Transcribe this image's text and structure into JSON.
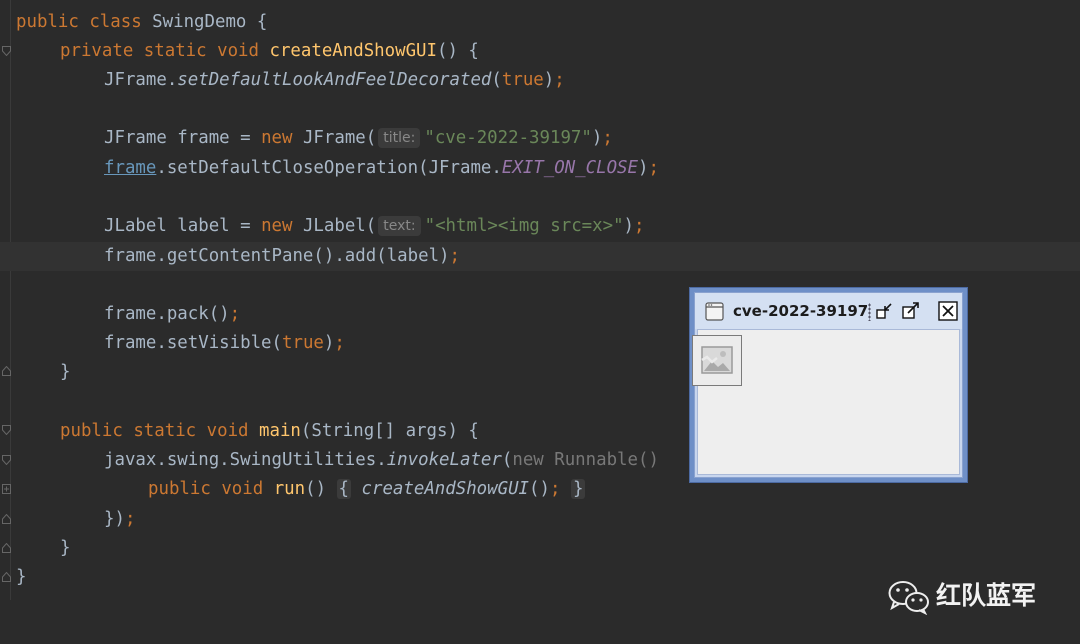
{
  "code": {
    "l1": {
      "k1": "public",
      "k2": "class",
      "name": "SwingDemo",
      "tail": " {"
    },
    "l2": {
      "k1": "private",
      "k2": "static",
      "k3": "void",
      "fn": "createAndShowGUI",
      "tail": "() {"
    },
    "l3": {
      "obj": "JFrame.",
      "method": "setDefaultLookAndFeelDecorated",
      "p1": "(",
      "val": "true",
      "p2": ")",
      "semi": ";"
    },
    "l5": {
      "pre": "JFrame frame = ",
      "kw": "new",
      "post": " JFrame(",
      "hint": "title:",
      "str": "\"cve-2022-39197\"",
      "close": ")",
      "semi": ";"
    },
    "l6": {
      "var": "frame",
      "mid": ".setDefaultCloseOperation(JFrame.",
      "const": "EXIT_ON_CLOSE",
      "close": ")",
      "semi": ";"
    },
    "l8": {
      "pre": "JLabel label = ",
      "kw": "new",
      "post": " JLabel(",
      "hint": "text:",
      "str": "\"<html><img src=x>\"",
      "close": ")",
      "semi": ";"
    },
    "l9": {
      "text": "frame.getContentPane().add(label)",
      "semi": ";"
    },
    "l11": {
      "text": "frame.pack()",
      "semi": ";"
    },
    "l12": {
      "pre": "frame.setVisible(",
      "val": "true",
      "close": ")",
      "semi": ";"
    },
    "l13": {
      "text": "}"
    },
    "l15": {
      "k1": "public",
      "k2": "static",
      "k3": "void",
      "fn": "main",
      "tail": "(String[] args) {"
    },
    "l16": {
      "pre": "javax.swing.SwingUtilities.",
      "method": "invokeLater",
      "paren": "(",
      "dim": "new Runnable()"
    },
    "l17": {
      "k1": "public",
      "k2": "void",
      "fn": "run",
      "tail": "() ",
      "ob": "{",
      "call": "createAndShowGUI",
      "after": "()",
      "semi": ";",
      "cb": "}"
    },
    "l18": {
      "text": "})",
      "semi": ";"
    },
    "l19": {
      "text": "}"
    },
    "l20": {
      "text": "}"
    }
  },
  "swing_window": {
    "title": "cve-2022-39197",
    "icons": [
      "window-app-icon",
      "iconify-icon",
      "maximize-icon",
      "close-icon",
      "broken-image-icon"
    ]
  },
  "watermark": {
    "text": "红队蓝军",
    "icon": "wechat-icon"
  },
  "colors": {
    "background": "#2b2b2b",
    "keyword": "#cc7832",
    "function": "#ffc66d",
    "string": "#6a8759",
    "text": "#a9b7c6"
  }
}
